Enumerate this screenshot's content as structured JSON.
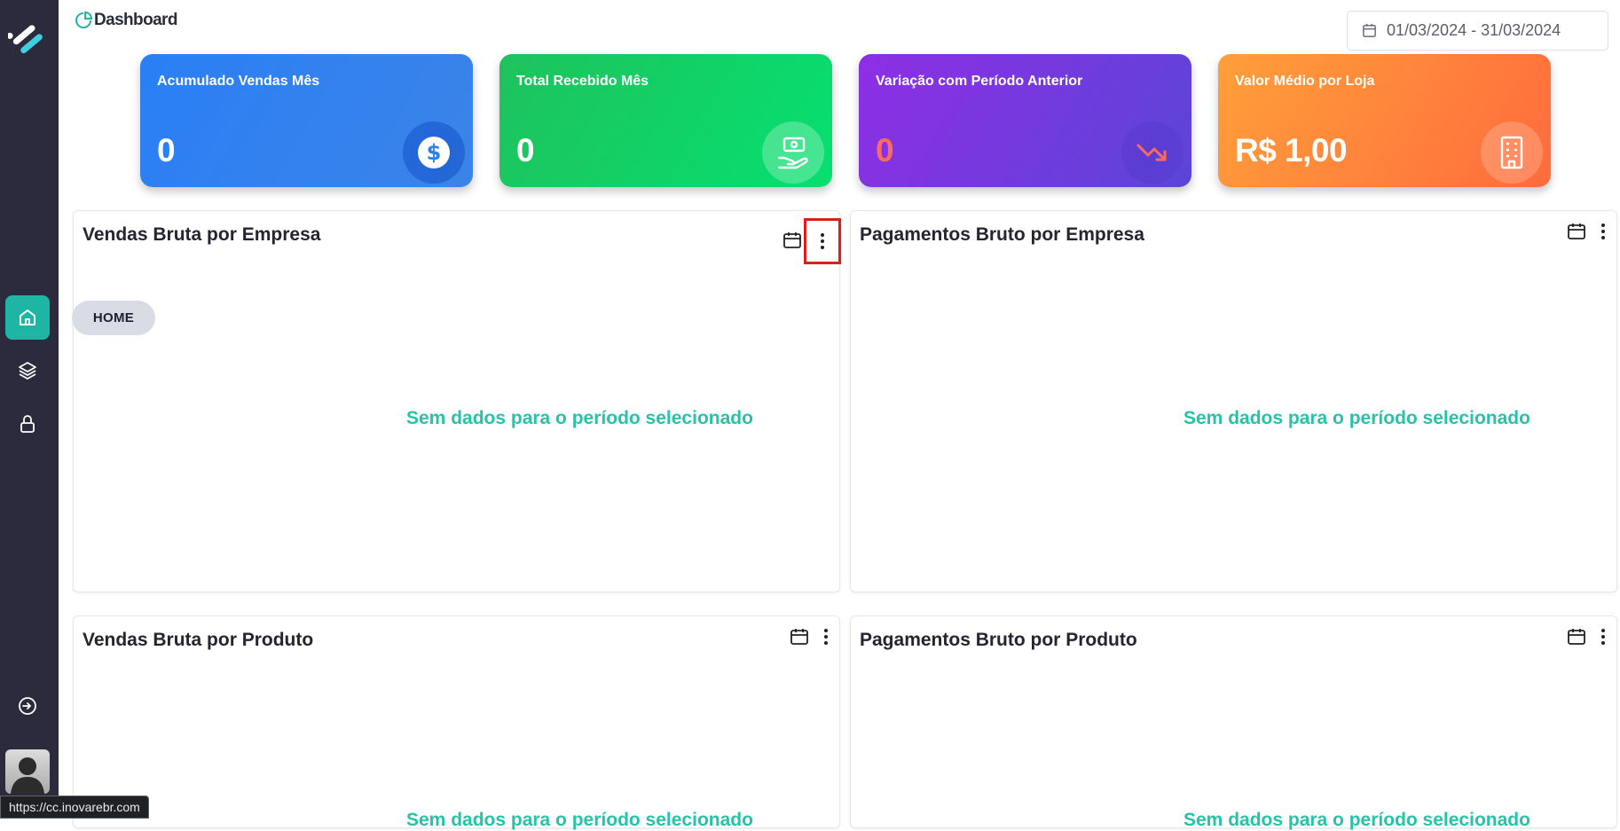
{
  "header": {
    "title": "Dashboard",
    "date_range": "01/03/2024 - 31/03/2024"
  },
  "sidebar": {
    "items": [
      {
        "name": "home",
        "icon": "home-icon",
        "active": true
      },
      {
        "name": "layers",
        "icon": "layers-icon",
        "active": false
      },
      {
        "name": "lock",
        "icon": "lock-icon",
        "active": false
      },
      {
        "name": "logout",
        "icon": "logout-icon",
        "active": false
      }
    ]
  },
  "kpis": [
    {
      "title": "Acumulado Vendas Mês",
      "value": "0",
      "icon": "dollar-icon",
      "color": "#2a7ff5"
    },
    {
      "title": "Total Recebido Mês",
      "value": "0",
      "icon": "money-hand-icon",
      "color": "#10d066"
    },
    {
      "title": "Variação com Período Anterior",
      "value": "0",
      "icon": "trend-down-icon",
      "color": "#7a36e0"
    },
    {
      "title": "Valor Médio por Loja",
      "value": "R$ 1,00",
      "icon": "building-icon",
      "color": "#ff7e3c"
    }
  ],
  "panels": [
    {
      "title": "Vendas Bruta por Empresa",
      "empty": "Sem dados para o período selecionado"
    },
    {
      "title": "Pagamentos Bruto por Empresa",
      "empty": "Sem dados para o período selecionado"
    },
    {
      "title": "Vendas Bruta por Produto",
      "empty": "Sem dados para o período selecionado"
    },
    {
      "title": "Pagamentos Bruto por Produto",
      "empty": "Sem dados para o período selecionado"
    }
  ],
  "home_tag": "HOME",
  "status_url": "https://cc.inovarebr.com"
}
